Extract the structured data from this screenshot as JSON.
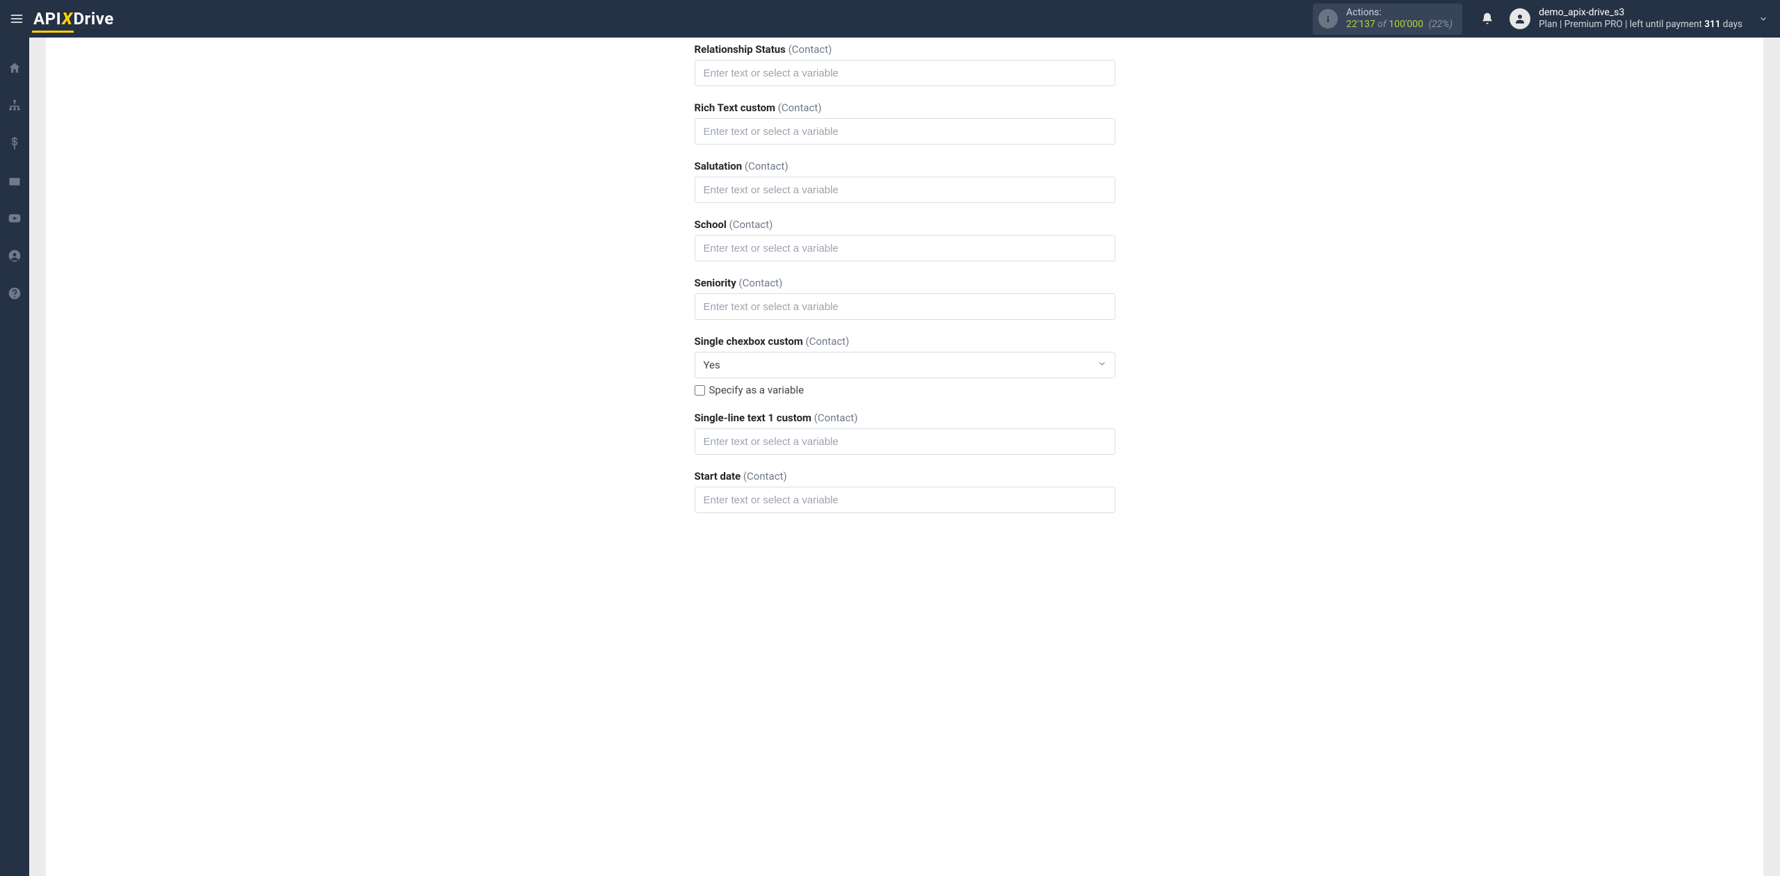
{
  "header": {
    "logo": {
      "part1": "API",
      "part2": "X",
      "part3": "Drive"
    },
    "actions": {
      "label": "Actions:",
      "used": "22'137",
      "of": "of",
      "total": "100'000",
      "percent": "(22%)"
    },
    "user": {
      "name": "demo_apix-drive_s3",
      "plan_prefix": "Plan |",
      "plan_name": "Premium PRO",
      "plan_mid": "| left until payment",
      "days": "311",
      "days_suffix": "days"
    }
  },
  "form": {
    "placeholder": "Enter text or select a variable",
    "fields": [
      {
        "id": "relationship-status",
        "label": "Relationship Status",
        "hint": "(Contact)",
        "type": "text"
      },
      {
        "id": "rich-text-custom",
        "label": "Rich Text custom",
        "hint": "(Contact)",
        "type": "text"
      },
      {
        "id": "salutation",
        "label": "Salutation",
        "hint": "(Contact)",
        "type": "text"
      },
      {
        "id": "school",
        "label": "School",
        "hint": "(Contact)",
        "type": "text"
      },
      {
        "id": "seniority",
        "label": "Seniority",
        "hint": "(Contact)",
        "type": "text"
      },
      {
        "id": "single-checkbox",
        "label": "Single chexbox custom",
        "hint": "(Contact)",
        "type": "select",
        "value": "Yes",
        "specify_label": "Specify as a variable"
      },
      {
        "id": "single-line-text-1",
        "label": "Single-line text 1 custom",
        "hint": "(Contact)",
        "type": "text"
      },
      {
        "id": "start-date",
        "label": "Start date",
        "hint": "(Contact)",
        "type": "text"
      }
    ]
  }
}
